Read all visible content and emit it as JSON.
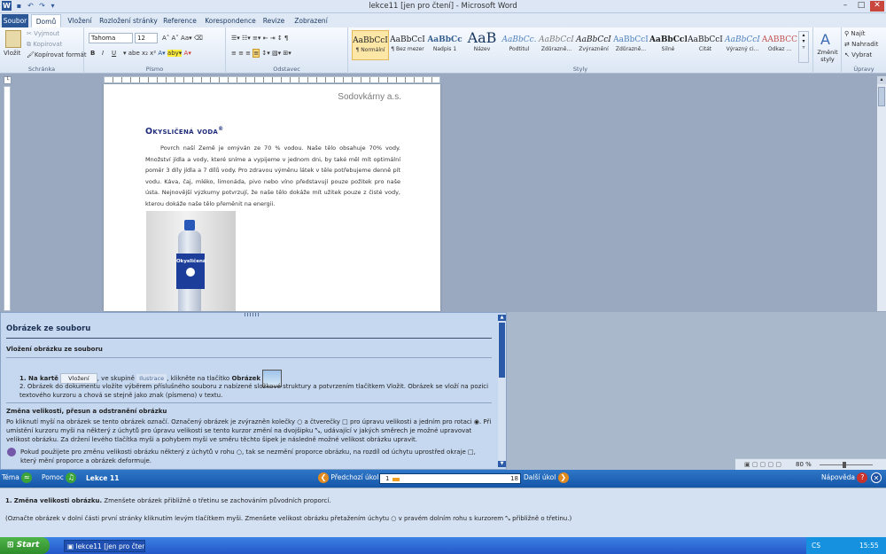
{
  "window": {
    "title": "lekce11 [jen pro čtení] - Microsoft Word",
    "min": "–",
    "max": "□",
    "close": "✕"
  },
  "tabs": [
    "Soubor",
    "Domů",
    "Vložení",
    "Rozložení stránky",
    "Reference",
    "Korespondence",
    "Revize",
    "Zobrazení"
  ],
  "ribbon": {
    "clipboard": {
      "paste": "Vložit",
      "cut": "Vyjmout",
      "copy": "Kopírovat",
      "format": "Kopírovat formát",
      "label": "Schránka"
    },
    "font": {
      "name": "Tahoma",
      "size": "12",
      "label": "Písmo",
      "bold": "B",
      "italic": "I",
      "underline": "U"
    },
    "paragraph": {
      "label": "Odstavec"
    },
    "styles": {
      "label": "Styly",
      "change": "Změnit styly",
      "items": [
        {
          "sample": "AaBbCcI",
          "name": "¶ Normální"
        },
        {
          "sample": "AaBbCcI",
          "name": "¶ Bez mezer"
        },
        {
          "sample": "AaBbCc",
          "name": "Nadpis 1"
        },
        {
          "sample": "AaB",
          "name": "Název"
        },
        {
          "sample": "AaBbCc.",
          "name": "Podtitul"
        },
        {
          "sample": "AaBbCcI",
          "name": "Zdůrazně..."
        },
        {
          "sample": "AaBbCcI",
          "name": "Zvýraznění"
        },
        {
          "sample": "AaBbCcI",
          "name": "Zdůrazně..."
        },
        {
          "sample": "AaBbCcI",
          "name": "Silné"
        },
        {
          "sample": "AaBbCcI",
          "name": "Citát"
        },
        {
          "sample": "AaBbCcI",
          "name": "Výrazný ci..."
        },
        {
          "sample": "AABBCC",
          "name": "Odkaz ..."
        }
      ]
    },
    "editing": {
      "find": "Najít",
      "replace": "Nahradit",
      "select": "Vybrat",
      "label": "Úpravy"
    }
  },
  "document": {
    "company": "Sodovkárny a.s.",
    "heading": "Okysličená voda",
    "heading_mark": "®",
    "paragraph": "Povrch naší Země je omýván ze 70 % vodou. Naše tělo obsahuje 70% vody. Množství jídla a vody, které sníme a vypijeme v jednom dni, by také měl mít optimální poměr 3 díly jídla a 7 dílů vody. Pro zdravou výměnu látek v těle potřebujeme denně pít vodu. Káva, čaj, mléko, limonáda, pivo nebo víno představují pouze požitek pro naše ústa. Nejnovější výzkumy potvrzují, že naše tělo dokáže mít užitek pouze z čisté vody, kterou dokáže naše tělo přeměnit na energii.",
    "bottle_label": "Okysličená"
  },
  "tutorial": {
    "title": "Obrázek ze souboru",
    "sub1": "Vložení obrázku ze souboru",
    "s1_a": "1. Na kartě",
    "s1_tab": "Vložení",
    "s1_b": ", ve skupině",
    "s1_group": "Ilustrace",
    "s1_c": ", klikněte na tlačítko",
    "s1_btn": "Obrázek",
    "s2": "2. Obrázek do dokumentu vložíte výběrem příslušného souboru z nabízené složkové struktury a potvrzením tlačítkem Vložit. Obrázek se vloží na pozici textového kurzoru a chová se stejně jako znak (písmeno) v textu.",
    "sub2": "Změna velikosti, přesun a odstranění obrázku",
    "p1": "Po kliknutí myší na obrázek se tento obrázek označí. Označený obrázek je zvýrazněn kolečky ○ a čtverečky □ pro úpravu velikosti a jedním pro rotaci ◉. Při umístění kurzoru myši na některý z úchytů pro úpravu velikosti se tento kurzor změní na dvojšipku ⤡, udávající v jakých směrech je možné upravovat velikost obrázku. Za držení levého tlačítka myši a pohybem myši ve směru těchto šipek je následně možné velikost obrázku upravit.",
    "p2": "Pokud použijete pro změnu velikosti obrázku některý z úchytů v rohu ○, tak se nezmění proporce obrázku, na rozdíl od úchytu uprostřed okraje □, který mění proporce a obrázek deformuje."
  },
  "status": {
    "zoom": "80 %"
  },
  "nav": {
    "topic": "Téma",
    "help": "Pomoc",
    "lesson": "Lekce 11",
    "prev": "Předchozí úkol",
    "step_from": "1",
    "step_to": "18",
    "progress": 0.06,
    "next": "Další úkol",
    "hint": "Nápověda"
  },
  "task": {
    "line1_num": "1.",
    "line1_b": "Změna velikosti obrázku.",
    "line1_rest": "Zmenšete obrázek přibližně o třetinu se zachováním původních proporcí.",
    "line2": "(Označte obrázek v dolní části první stránky kliknutím levým tlačítkem myši. Zmenšete velikost obrázku přetažením úchytu ○ v pravém dolním rohu s kurzorem ⤡ přibližně o třetinu.)"
  },
  "taskbar": {
    "start": "Start",
    "item": "lekce11 [jen pro čtení]...",
    "lang": "CS",
    "time": "15:55"
  }
}
